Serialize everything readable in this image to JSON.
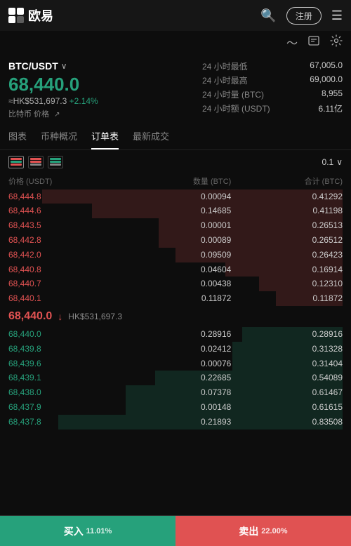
{
  "header": {
    "logo_text": "欧易",
    "register_label": "注册",
    "menu_icon": "☰",
    "search_icon": "🔍"
  },
  "ticker": {
    "pair": "BTC/USDT",
    "price": "68,440.0",
    "hk_price": "≈HK$531,697.3",
    "change": "+2.14%",
    "label": "比特币 价格",
    "stats": [
      {
        "label": "24 小时最低",
        "value": "67,005.0"
      },
      {
        "label": "24 小时最高",
        "value": "69,000.0"
      },
      {
        "label": "24 小时量 (BTC)",
        "value": "8,955"
      },
      {
        "label": "24 小时额 (USDT)",
        "value": "6.11亿"
      }
    ]
  },
  "tabs": [
    {
      "label": "图表",
      "active": false
    },
    {
      "label": "币种概况",
      "active": false
    },
    {
      "label": "订单表",
      "active": true
    },
    {
      "label": "最新成交",
      "active": false
    }
  ],
  "orderbook": {
    "precision": "0.1",
    "col_headers": [
      "价格 (USDT)",
      "数量 (BTC)",
      "合计 (BTC)"
    ],
    "sell_orders": [
      {
        "price": "68,444.8",
        "qty": "0.00094",
        "total": "0.41292",
        "depth": 90
      },
      {
        "price": "68,444.6",
        "qty": "0.14685",
        "total": "0.41198",
        "depth": 75
      },
      {
        "price": "68,443.5",
        "qty": "0.00001",
        "total": "0.26513",
        "depth": 55
      },
      {
        "price": "68,442.8",
        "qty": "0.00089",
        "total": "0.26512",
        "depth": 55
      },
      {
        "price": "68,442.0",
        "qty": "0.09509",
        "total": "0.26423",
        "depth": 50
      },
      {
        "price": "68,440.8",
        "qty": "0.04604",
        "total": "0.16914",
        "depth": 35
      },
      {
        "price": "68,440.7",
        "qty": "0.00438",
        "total": "0.12310",
        "depth": 25
      },
      {
        "price": "68,440.1",
        "qty": "0.11872",
        "total": "0.11872",
        "depth": 20
      }
    ],
    "mid_price": "68,440.0",
    "mid_hk": "HK$531,697.3",
    "mid_direction": "down",
    "buy_orders": [
      {
        "price": "68,440.0",
        "qty": "0.28916",
        "total": "0.28916",
        "depth": 30
      },
      {
        "price": "68,439.8",
        "qty": "0.02412",
        "total": "0.31328",
        "depth": 33
      },
      {
        "price": "68,439.6",
        "qty": "0.00076",
        "total": "0.31404",
        "depth": 33
      },
      {
        "price": "68,439.1",
        "qty": "0.22685",
        "total": "0.54089",
        "depth": 56
      },
      {
        "price": "68,438.0",
        "qty": "0.07378",
        "total": "0.61467",
        "depth": 65
      },
      {
        "price": "68,437.9",
        "qty": "0.00148",
        "total": "0.61615",
        "depth": 65
      },
      {
        "price": "68,437.8",
        "qty": "0.21893",
        "total": "0.83508",
        "depth": 85
      }
    ]
  },
  "bottom": {
    "buy_label": "买入",
    "buy_pct": "11.01%",
    "sell_label": "卖出",
    "sell_pct": "22.00%"
  }
}
